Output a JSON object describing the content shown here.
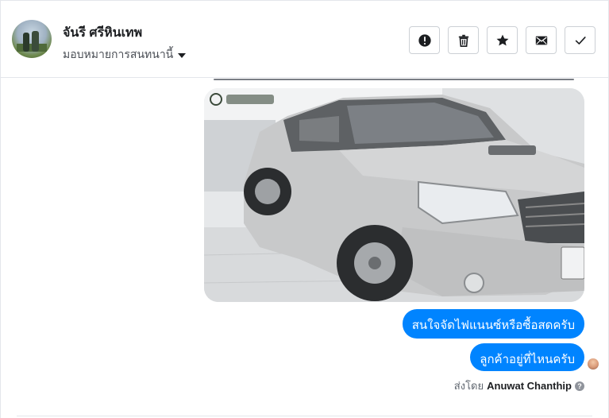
{
  "header": {
    "contact_name": "จันรี ศรีหินเทพ",
    "assign_label": "มอบหมายการสนทนานี้"
  },
  "actions": [
    {
      "name": "report-button",
      "icon": "exclamation-circle-icon"
    },
    {
      "name": "delete-button",
      "icon": "trash-icon"
    },
    {
      "name": "star-button",
      "icon": "star-icon"
    },
    {
      "name": "mark-unread-button",
      "icon": "envelope-icon"
    },
    {
      "name": "done-button",
      "icon": "checkmark-icon"
    }
  ],
  "messages": [
    {
      "type": "image",
      "alt": "silver pickup truck photo"
    },
    {
      "type": "text",
      "text": "สนใจจัดไฟแนนซ์หรือซื้อสดครับ"
    },
    {
      "type": "text",
      "text": "ลูกค้าอยู่ที่ไหนครับ"
    }
  ],
  "sent_by": {
    "prefix": "ส่งโดย",
    "author": "Anuwat Chanthip"
  },
  "colors": {
    "bubble": "#0084ff",
    "border": "#ccd0d5"
  }
}
